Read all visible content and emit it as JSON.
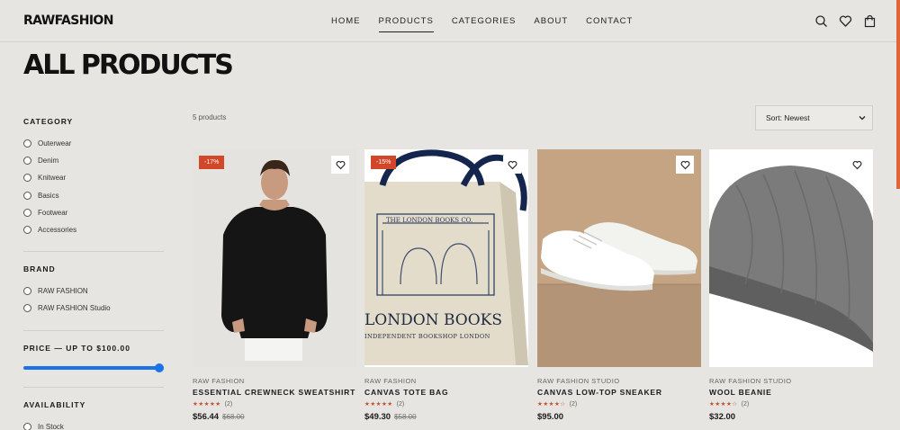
{
  "header": {
    "logo": "RAWFASHION",
    "nav": [
      "HOME",
      "PRODUCTS",
      "CATEGORIES",
      "ABOUT",
      "CONTACT"
    ],
    "active_nav": "PRODUCTS",
    "icons": [
      "search-icon",
      "heart-icon",
      "bag-icon"
    ]
  },
  "page": {
    "title": "ALL PRODUCTS",
    "count": "5 products",
    "sort": "Sort: Newest"
  },
  "filters": {
    "category": {
      "heading": "CATEGORY",
      "options": [
        "Outerwear",
        "Denim",
        "Knitwear",
        "Basics",
        "Footwear",
        "Accessories"
      ]
    },
    "brand": {
      "heading": "BRAND",
      "options": [
        "RAW FASHION",
        "RAW FASHION Studio"
      ]
    },
    "price": {
      "heading": "PRICE — UP TO $100.00",
      "fill_fraction": 1.0
    },
    "availability": {
      "heading": "AVAILABILITY",
      "options": [
        "In Stock"
      ]
    }
  },
  "products": [
    {
      "brand": "RAW FASHION",
      "name": "ESSENTIAL CREWNECK SWEATSHIRT",
      "badge": "-17%",
      "stars": "★★★★★",
      "reviews": "(2)",
      "price": "$56.44",
      "old_price": "$68.00"
    },
    {
      "brand": "RAW FASHION",
      "name": "CANVAS TOTE BAG",
      "badge": "-15%",
      "stars": "★★★★★",
      "reviews": "(2)",
      "price": "$49.30",
      "old_price": "$58.00",
      "print_title": "LONDON BOOKS",
      "print_sub": "INDEPENDENT BOOKSHOP LONDON",
      "print_small": "THE LONDON BOOKS CO."
    },
    {
      "brand": "RAW FASHION STUDIO",
      "name": "CANVAS LOW-TOP SNEAKER",
      "badge": "",
      "stars": "★★★★☆",
      "reviews": "(2)",
      "price": "$95.00",
      "old_price": ""
    },
    {
      "brand": "RAW FASHION STUDIO",
      "name": "WOOL BEANIE",
      "badge": "",
      "stars": "★★★★☆",
      "reviews": "(2)",
      "price": "$32.00",
      "old_price": ""
    }
  ],
  "colors": {
    "accent": "#e0663a",
    "badge": "#d2472a",
    "slider": "#1a73e8",
    "background": "#e6e5e1"
  }
}
